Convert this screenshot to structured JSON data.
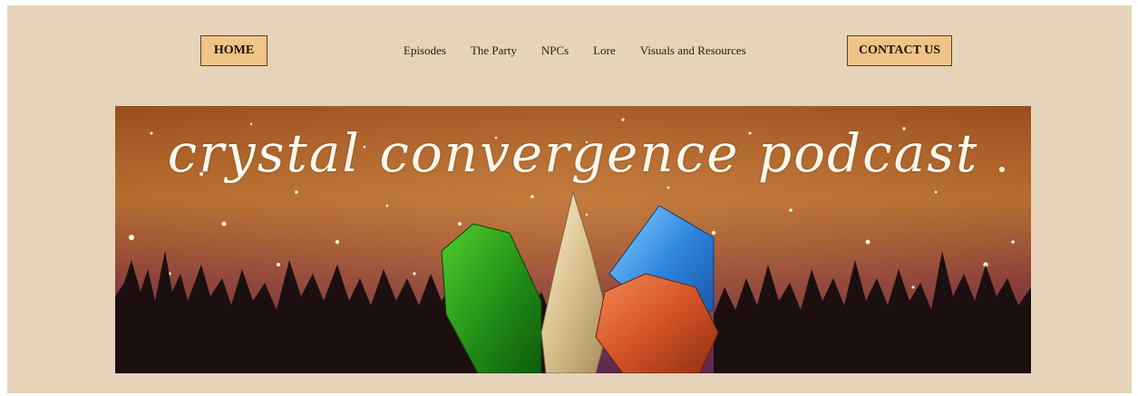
{
  "nav": {
    "home_label": "HOME",
    "links": [
      "Episodes",
      "The Party",
      "NPCs",
      "Lore",
      "Visuals and Resources"
    ],
    "contact_label": "CONTACT US"
  },
  "banner": {
    "title": "crystal convergence podcast"
  },
  "colors": {
    "page_background": "#e6d3b9",
    "button_fill": "#f0c386",
    "button_border": "#5b4226"
  }
}
